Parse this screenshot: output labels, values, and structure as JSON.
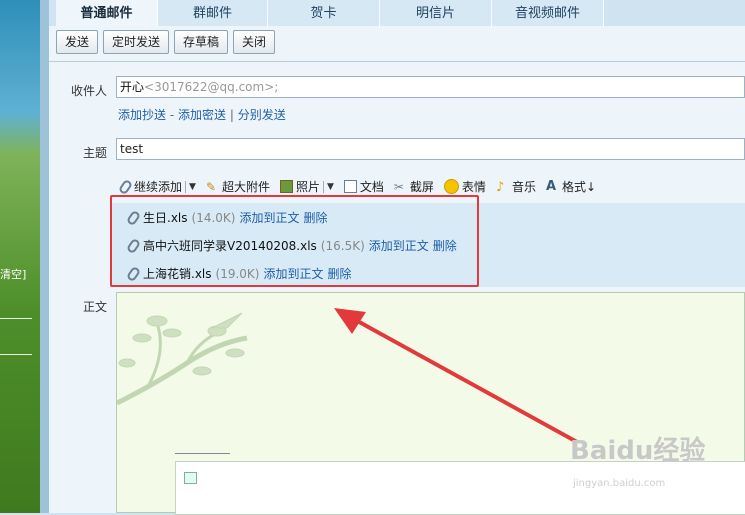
{
  "background": {
    "clear_label": "清空]"
  },
  "tabs": [
    "普通邮件",
    "群邮件",
    "贺卡",
    "明信片",
    "音视频邮件"
  ],
  "toolbar": {
    "send": "发送",
    "schedule": "定时发送",
    "draft": "存草稿",
    "close": "关闭"
  },
  "form": {
    "to_label": "收件人",
    "to_name": "开心",
    "to_addr": "<3017622@qq.com>;",
    "add_cc": "添加抄送",
    "add_bcc": "添加密送",
    "separate": "分别发送",
    "subject_label": "主题",
    "subject_value": "test",
    "body_label": "正文"
  },
  "attach_toolbar": {
    "continue_add": "继续添加",
    "large_attach": "超大附件",
    "photo": "照片",
    "document": "文档",
    "screenshot": "截屏",
    "emoji": "表情",
    "music": "音乐",
    "format": "格式↓"
  },
  "attachments": [
    {
      "name": "生日.xls",
      "size": "(14.0K)",
      "add": "添加到正文",
      "del": "删除"
    },
    {
      "name": "高中六班同学录V20140208.xls",
      "size": "(16.5K)",
      "add": "添加到正文",
      "del": "删除"
    },
    {
      "name": "上海花销.xls",
      "size": "(19.0K)",
      "add": "添加到正文",
      "del": "删除"
    }
  ],
  "colors": {
    "highlight": "#e23a3a",
    "link": "#1e5fa8"
  },
  "watermark": {
    "logo": "Baidu经验",
    "url": "jingyan.baidu.com"
  }
}
